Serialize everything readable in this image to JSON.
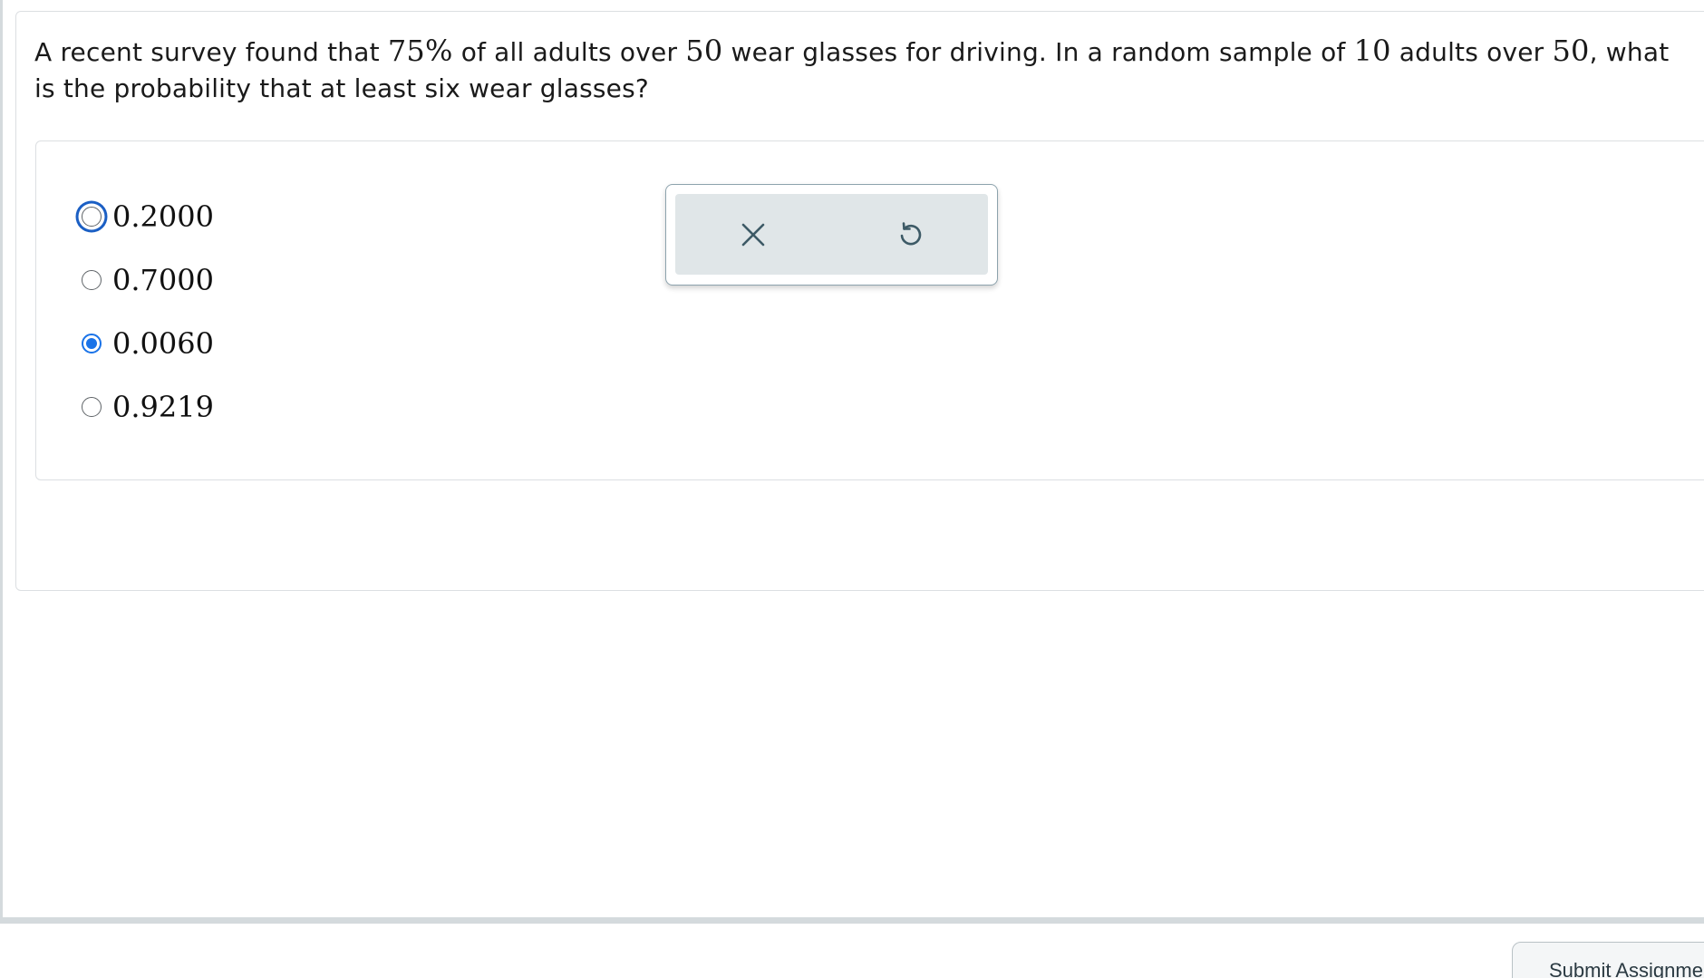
{
  "question": {
    "text_1": "A recent survey found that ",
    "math_percent": "75%",
    "text_2": " of all adults over ",
    "math_age_1": "50",
    "text_3": " wear glasses for driving. In a random sample of ",
    "math_sample": "10",
    "text_4": " adults over ",
    "math_age_2": "50",
    "text_5": ", what is the probability that at least six wear glasses?"
  },
  "answer_options": [
    {
      "label": "0.2000",
      "selected": false,
      "focused": true
    },
    {
      "label": "0.7000",
      "selected": false,
      "focused": false
    },
    {
      "label": "0.0060",
      "selected": true,
      "focused": false
    },
    {
      "label": "0.9219",
      "selected": false,
      "focused": false
    }
  ],
  "tool_popup": {
    "clear_icon": "close-icon",
    "undo_icon": "undo-icon"
  },
  "footer": {
    "submit_label": "Submit Assignment"
  },
  "colors": {
    "accent": "#1a73e8",
    "focus_ring": "#1b5fc4",
    "border": "#dcdfe2",
    "popup_fill": "#e0e6e8",
    "icon": "#3d5a66"
  }
}
